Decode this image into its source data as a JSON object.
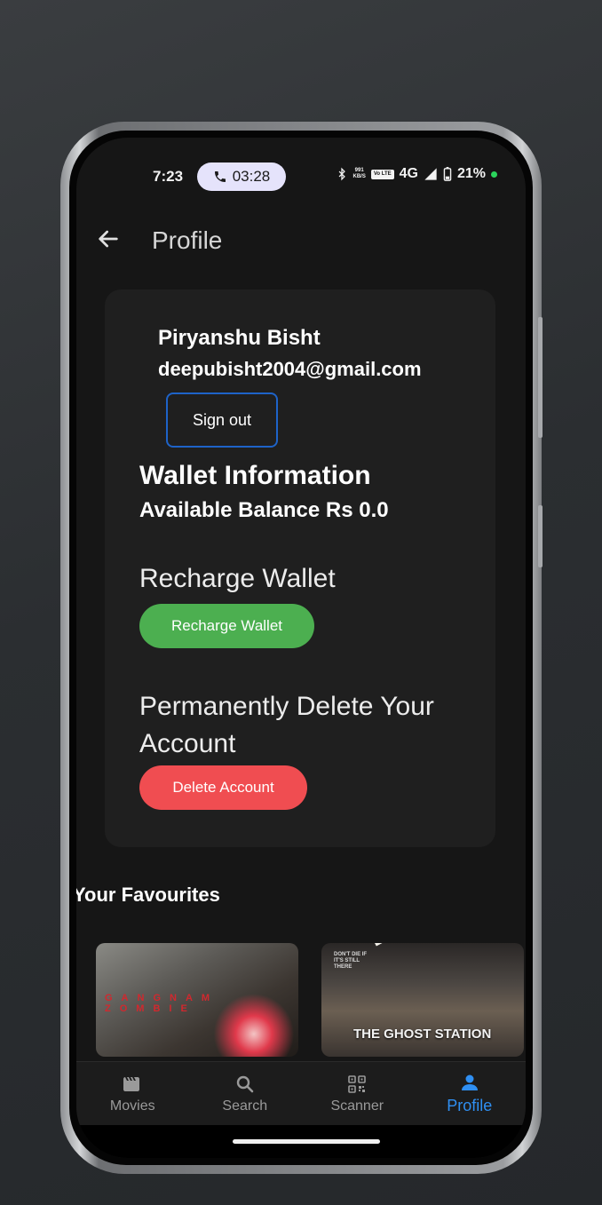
{
  "status_bar": {
    "time": "7:23",
    "call_timer": "03:28",
    "data_speed_value": "991",
    "data_speed_unit": "KB/S",
    "volte_label": "Vo LTE",
    "network": "4G",
    "battery": "21%"
  },
  "app_bar": {
    "title": "Profile",
    "back_icon": "arrow-left-icon"
  },
  "profile": {
    "name": "Piryanshu Bisht",
    "email": "deepubisht2004@gmail.com",
    "sign_out_label": "Sign out"
  },
  "wallet": {
    "title": "Wallet Information",
    "balance_text": "Available Balance Rs 0.0",
    "recharge_heading": "Recharge Wallet",
    "recharge_button": "Recharge Wallet"
  },
  "account": {
    "delete_heading": "Permanently Delete Your Account",
    "delete_button": "Delete Account"
  },
  "favourites": {
    "title": "Your Favourites",
    "posters": [
      {
        "title_text": "GANGNAM ZOMBIE"
      },
      {
        "title_text": "THE GHOST STATION",
        "tagline": "DON'T DIE IF IT'S STILL THERE"
      }
    ]
  },
  "bottom_nav": {
    "items": [
      {
        "label": "Movies",
        "icon": "clapperboard-icon"
      },
      {
        "label": "Search",
        "icon": "search-icon"
      },
      {
        "label": "Scanner",
        "icon": "qr-code-icon"
      },
      {
        "label": "Profile",
        "icon": "person-icon",
        "active": true
      }
    ]
  },
  "colors": {
    "accent_active": "#2f8ff2",
    "recharge_green": "#4caf50",
    "delete_red": "#f04d51",
    "signout_border": "#1e63c8"
  }
}
